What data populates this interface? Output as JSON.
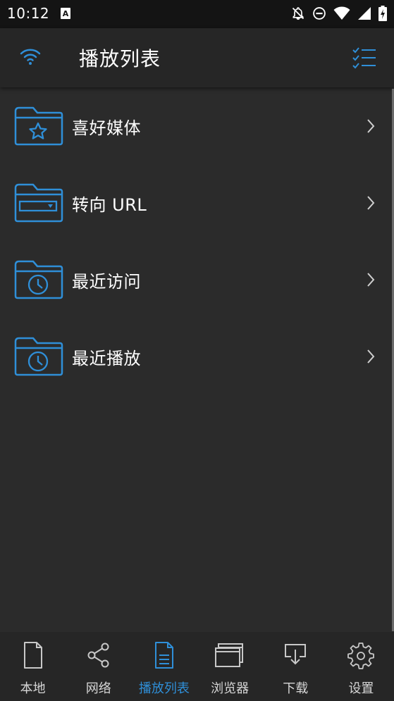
{
  "status_bar": {
    "time": "10:12"
  },
  "app_bar": {
    "title": "播放列表"
  },
  "list": [
    {
      "label": "喜好媒体",
      "icon": "star-folder-icon"
    },
    {
      "label": "转向 URL",
      "icon": "url-folder-icon"
    },
    {
      "label": "最近访问",
      "icon": "clock-folder-icon"
    },
    {
      "label": "最近播放",
      "icon": "clock-folder-icon"
    }
  ],
  "bottom_nav": [
    {
      "label": "本地",
      "icon": "file-icon",
      "active": false
    },
    {
      "label": "网络",
      "icon": "share-icon",
      "active": false
    },
    {
      "label": "播放列表",
      "icon": "playlist-document-icon",
      "active": true
    },
    {
      "label": "浏览器",
      "icon": "browser-window-icon",
      "active": false
    },
    {
      "label": "下载",
      "icon": "download-icon",
      "active": false
    },
    {
      "label": "设置",
      "icon": "gear-icon",
      "active": false
    }
  ],
  "colors": {
    "accent": "#2f8fd8",
    "background": "#2b2b2b",
    "app_bar": "#262626",
    "status_bar": "#141414"
  }
}
